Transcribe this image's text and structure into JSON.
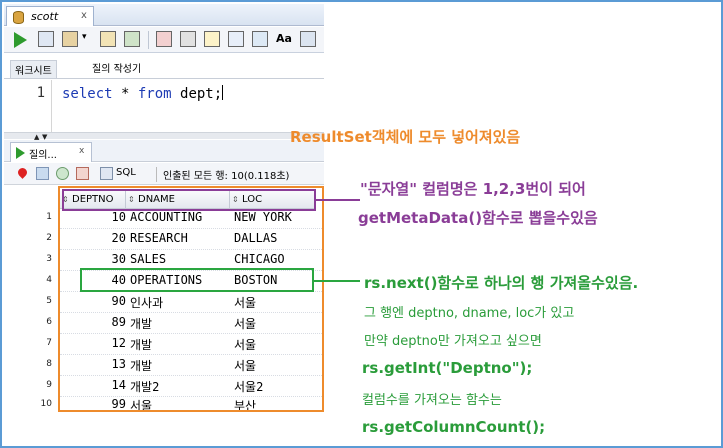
{
  "window": {
    "tab_title": "scott",
    "close": "x"
  },
  "toolbar": {
    "format_label": "Aa"
  },
  "editor_tabs": [
    "워크시트",
    "질의 작성기"
  ],
  "editor": {
    "line_number": "1",
    "kw_select": "select",
    "star": " * ",
    "kw_from": "from",
    "rest": " dept;"
  },
  "results": {
    "tab_label": "질의...",
    "close": "x",
    "sql_label": "SQL",
    "status": "인출된 모든 행: 10(0.118초)",
    "columns": [
      "DEPTNO",
      "DNAME",
      "LOC"
    ],
    "rows": [
      {
        "num": "1",
        "deptno": "10",
        "dname": "ACCOUNTING",
        "loc": "NEW YORK"
      },
      {
        "num": "2",
        "deptno": "20",
        "dname": "RESEARCH",
        "loc": "DALLAS"
      },
      {
        "num": "3",
        "deptno": "30",
        "dname": "SALES",
        "loc": "CHICAGO"
      },
      {
        "num": "4",
        "deptno": "40",
        "dname": "OPERATIONS",
        "loc": "BOSTON"
      },
      {
        "num": "5",
        "deptno": "90",
        "dname": "인사과",
        "loc": "서울"
      },
      {
        "num": "6",
        "deptno": "89",
        "dname": "개발",
        "loc": "서울"
      },
      {
        "num": "7",
        "deptno": "12",
        "dname": "개발",
        "loc": "서울"
      },
      {
        "num": "8",
        "deptno": "13",
        "dname": "개발",
        "loc": "서울"
      },
      {
        "num": "9",
        "deptno": "14",
        "dname": "개발2",
        "loc": "서울2"
      },
      {
        "num": "10",
        "deptno": "99",
        "dname": "서울",
        "loc": "부산"
      }
    ]
  },
  "annotations": {
    "resultset": "ResultSet객체에 모두 넣어져있음",
    "colname": "\"문자열\" 컬럼명은 1,2,3번이 되어",
    "metadata": "getMetaData()함수로 뽑을수있음",
    "next": "rs.next()함수로 하나의 행 가져올수있음.",
    "row_has": "그 행엔 deptno, dname, loc가 있고",
    "only_deptno": "만약 deptno만 가져오고 싶으면",
    "getint": "rs.getInt(\"Deptno\");",
    "colcount_desc": "컬럼수를 가져오는 함수는",
    "colcount": "rs.getColumnCount();"
  },
  "colors": {
    "orange": "#ee8b2c",
    "purple": "#8a3d97",
    "green": "#2aa640",
    "keyword": "#1d3bb4"
  }
}
